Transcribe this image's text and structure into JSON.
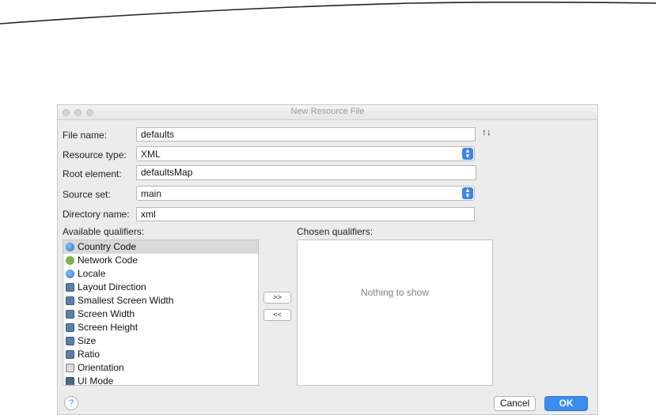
{
  "window": {
    "title": "New Resource File"
  },
  "form": {
    "file_name": {
      "label": "File name:",
      "value": "defaults"
    },
    "resource_type": {
      "label": "Resource type:",
      "value": "XML"
    },
    "root_element": {
      "label": "Root element:",
      "value": "defaultsMap"
    },
    "source_set": {
      "label": "Source set:",
      "value": "main"
    },
    "directory_name": {
      "label": "Directory name:",
      "value": "xml"
    }
  },
  "available": {
    "label": "Available qualifiers:",
    "items": [
      {
        "label": "Country Code",
        "icon": "globe-icon"
      },
      {
        "label": "Network Code",
        "icon": "network-icon"
      },
      {
        "label": "Locale",
        "icon": "globe-icon"
      },
      {
        "label": "Layout Direction",
        "icon": "layout-direction-icon"
      },
      {
        "label": "Smallest Screen Width",
        "icon": "smallest-width-icon"
      },
      {
        "label": "Screen Width",
        "icon": "screen-width-icon"
      },
      {
        "label": "Screen Height",
        "icon": "screen-height-icon"
      },
      {
        "label": "Size",
        "icon": "size-icon"
      },
      {
        "label": "Ratio",
        "icon": "ratio-icon"
      },
      {
        "label": "Orientation",
        "icon": "orientation-icon"
      },
      {
        "label": "UI Mode",
        "icon": "ui-mode-icon"
      }
    ],
    "selected": "Country Code"
  },
  "chosen": {
    "label": "Chosen qualifiers:",
    "empty_text": "Nothing to show"
  },
  "buttons": {
    "add": ">>",
    "remove": "<<",
    "cancel": "Cancel",
    "ok": "OK",
    "help": "?"
  },
  "colors": {
    "accent": "#3a8cf0",
    "dialog_bg": "#ececec"
  }
}
